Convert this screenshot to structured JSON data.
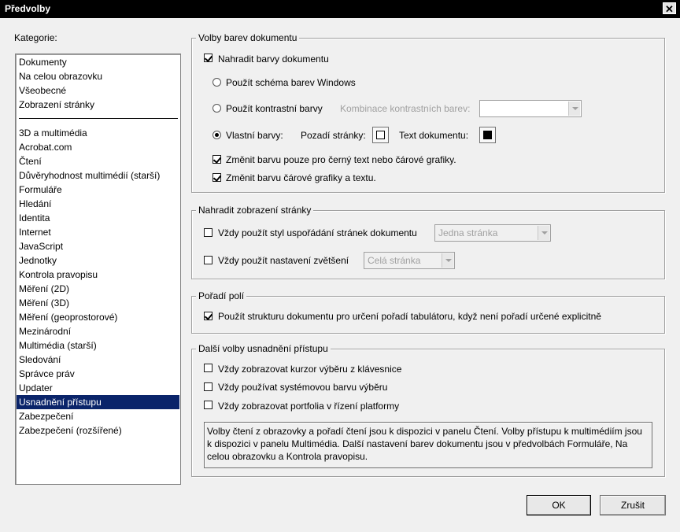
{
  "window": {
    "title": "Předvolby",
    "close_label": "✕"
  },
  "categories": {
    "label": "Kategorie:",
    "group1": [
      "Dokumenty",
      "Na celou obrazovku",
      "Všeobecné",
      "Zobrazení stránky"
    ],
    "group2": [
      "3D a multimédia",
      "Acrobat.com",
      "Čtení",
      "Důvěryhodnost multimédií (starší)",
      "Formuláře",
      "Hledání",
      "Identita",
      "Internet",
      "JavaScript",
      "Jednotky",
      "Kontrola pravopisu",
      "Měření (2D)",
      "Měření (3D)",
      "Měření (geoprostorové)",
      "Mezinárodní",
      "Multimédia (starší)",
      "Sledování",
      "Správce práv",
      "Updater",
      "Usnadnění přístupu",
      "Zabezpečení",
      "Zabezpečení (rozšířené)"
    ],
    "selected": "Usnadnění přístupu"
  },
  "doc_colors": {
    "legend": "Volby barev dokumentu",
    "replace_label": "Nahradit barvy dokumentu",
    "replace_checked": true,
    "use_windows_scheme": "Použít schéma barev Windows",
    "use_contrast": "Použít kontrastní barvy",
    "contrast_combo_label": "Kombinace kontrastních barev:",
    "contrast_combo_value": "",
    "custom_colors": "Vlastní barvy:",
    "custom_selected": true,
    "page_bg_label": "Pozadí stránky:",
    "page_bg_color": "#ffffff",
    "doc_text_label": "Text dokumentu:",
    "doc_text_color": "#000000",
    "only_black_text": "Změnit barvu pouze pro černý text nebo čárové grafiky.",
    "only_black_checked": true,
    "change_line_art": "Změnit barvu čárové grafiky a textu.",
    "change_line_art_checked": true
  },
  "page_display": {
    "legend": "Nahradit zobrazení stránky",
    "layout_label": "Vždy použít styl uspořádání stránek dokumentu",
    "layout_value": "Jedna stránka",
    "zoom_label": "Vždy použít nastavení zvětšení",
    "zoom_value": "Celá stránka"
  },
  "tab_order": {
    "legend": "Pořadí polí",
    "label": "Použít strukturu dokumentu pro určení pořadí tabulátoru, když není pořadí určené explicitně",
    "checked": true
  },
  "other": {
    "legend": "Další volby usnadnění přístupu",
    "keyboard_cursor": "Vždy zobrazovat kurzor výběru z klávesnice",
    "system_color": "Vždy používat systémovou barvu výběru",
    "portfolio": "Vždy zobrazovat portfolia v řízení platformy",
    "info": "Volby čtení z obrazovky a pořadí čtení jsou k dispozici v panelu Čtení. Volby přístupu k multimédiím jsou k dispozici v panelu Multimédia. Další nastavení barev dokumentu jsou v předvolbách Formuláře, Na celou obrazovku a Kontrola pravopisu."
  },
  "buttons": {
    "ok": "OK",
    "cancel": "Zrušit"
  },
  "colors": {
    "selection": "#0a246a",
    "titlebar": "#000000",
    "dialog_bg": "#f0f0f0"
  }
}
